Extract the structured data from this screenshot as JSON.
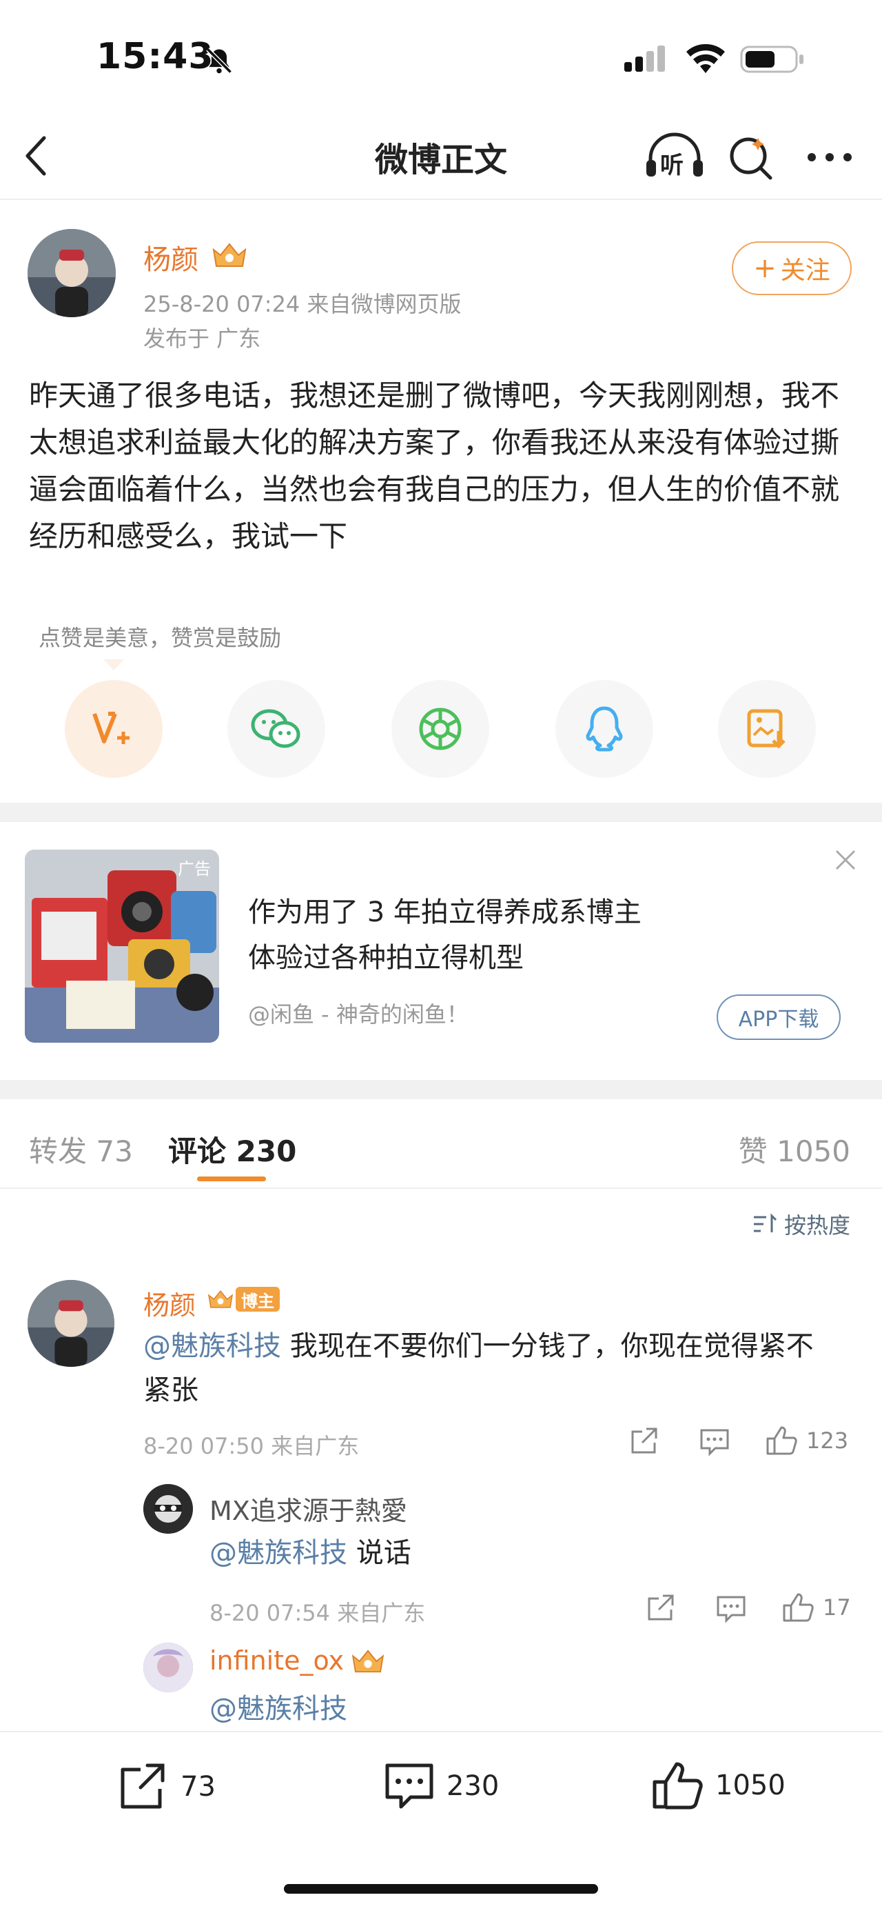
{
  "status_bar": {
    "time": "15:43"
  },
  "nav": {
    "title": "微博正文",
    "listen_label": "听"
  },
  "post": {
    "author": "杨颜",
    "time_source": "25-8-20 07:24  来自微博网页版",
    "location": "发布于 广东",
    "follow_label": "关注",
    "text": "昨天通了很多电话，我想还是删了微博吧，今天我刚刚想，我不太想追求利益最大化的解决方案了，你看我还从来没有体验过撕逼会面临着什么，当然也会有我自己的压力，但人生的价值不就经历和感受么，我试一下",
    "reward_tip": "点赞是美意，赞赏是鼓励"
  },
  "ad": {
    "tag": "广告",
    "line1": "作为用了 3 年拍立得养成系博主",
    "line2": "体验过各种拍立得机型",
    "source": "@闲鱼 - 神奇的闲鱼！",
    "button": "APP下载"
  },
  "tabs": {
    "repost": "转发 73",
    "comment_label": "评论",
    "comment_count": "230",
    "like": "赞 1050"
  },
  "sort_label": "按热度",
  "comments": [
    {
      "author": "杨颜",
      "badge": "博主",
      "mention": "@魅族科技",
      "text": " 我现在不要你们一分钱了，你现在觉得紧不紧张",
      "meta": "8-20 07:50  来自广东",
      "likes": "123"
    }
  ],
  "replies": [
    {
      "author": "MX追求源于熱愛",
      "mention": "@魅族科技",
      "text": " 说话",
      "meta": "8-20 07:54  来自广东",
      "likes": "17"
    },
    {
      "author": "infinite_ox",
      "mention": "@魅族科技"
    }
  ],
  "bottom_bar": {
    "reposts": "73",
    "comments": "230",
    "likes": "1050"
  },
  "colors": {
    "accent": "#f08a2d",
    "mention": "#5a7fa6"
  }
}
